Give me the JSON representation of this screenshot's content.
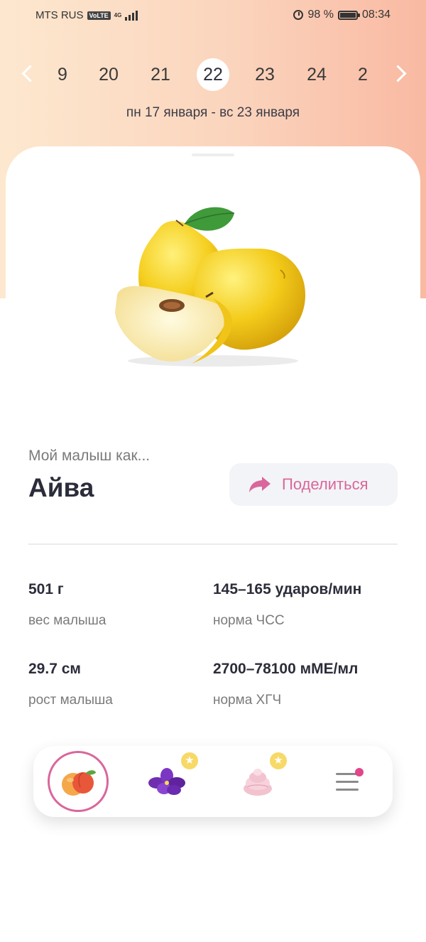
{
  "status_bar": {
    "carrier": "MTS RUS",
    "volte": "VoLTE",
    "network": "4G",
    "battery": "98 %",
    "time": "08:34"
  },
  "calendar": {
    "days": [
      "9",
      "20",
      "21",
      "22",
      "23",
      "24",
      "2"
    ],
    "selected_day": "22",
    "week_range": "пн 17 января - вс 23 января"
  },
  "baby": {
    "subtitle": "Мой малыш как...",
    "fruit_name": "Айва",
    "fruit_image": "quince-image",
    "share_label": "Поделиться"
  },
  "stats": [
    {
      "value": "501 г",
      "label": "вес малыша"
    },
    {
      "value": "145–165 ударов/мин",
      "label": "норма ЧСС"
    },
    {
      "value": "29.7 см",
      "label": "рост малыша"
    },
    {
      "value": "2700–78100 мМЕ/мл",
      "label": "норма ХГЧ"
    }
  ],
  "bottom_nav": [
    {
      "icon": "peach-icon",
      "active": true,
      "badge": "none"
    },
    {
      "icon": "violet-flower-icon",
      "active": false,
      "badge": "star"
    },
    {
      "icon": "marshmallow-icon",
      "active": false,
      "badge": "star"
    },
    {
      "icon": "menu-icon",
      "active": false,
      "badge": "dot"
    }
  ],
  "colors": {
    "accent": "#d9679b",
    "gradient_start": "#fde8cf",
    "gradient_end": "#f9b9a2",
    "text_dark": "#2c2d3a",
    "text_muted": "#7a7a7a",
    "star": "#f7d968",
    "notification_dot": "#e0468a"
  }
}
